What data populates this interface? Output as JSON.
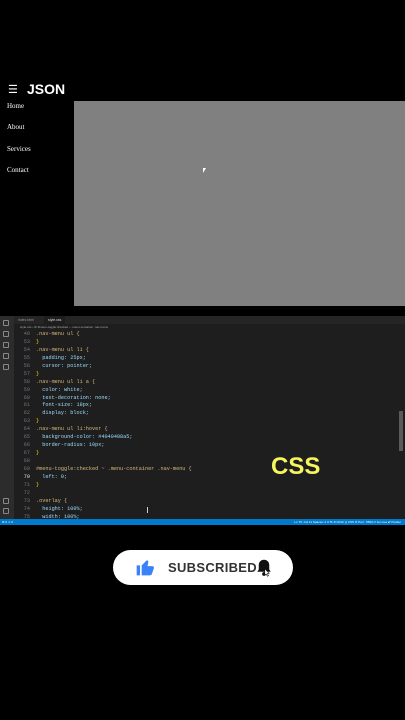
{
  "demo": {
    "menu_icon": "hamburger-icon",
    "menu_glyph": "☰",
    "title": "JSON",
    "nav": [
      "Home",
      "About",
      "Services",
      "Contact"
    ],
    "overlay_color": "#808080"
  },
  "editor": {
    "tabs": [
      "index.html",
      "style.css"
    ],
    "breadcrumb": "style.css › ⚙ #menu-toggle:checked ~ .menu-container .nav-menu",
    "status_left": "⊗ 0 ⚠ 0",
    "status_right": "Ln 70, Col 11   Spaces: 2   UTF-8   CRLF   {} CSS   ⦾ Port : 5500   ⊘ Go Live   ✔ Prettier",
    "accent": "#007acc",
    "lines": [
      {
        "n": "49",
        "text": ".nav-menu ul {"
      },
      {
        "n": "53",
        "text": "}"
      },
      {
        "n": "54",
        "text": ".nav-menu ul li {"
      },
      {
        "n": "55",
        "text": "  padding: 25px;"
      },
      {
        "n": "56",
        "text": "  cursor: pointer;"
      },
      {
        "n": "57",
        "text": "}"
      },
      {
        "n": "58",
        "text": ".nav-menu ul li a {"
      },
      {
        "n": "59",
        "text": "  color: white;"
      },
      {
        "n": "60",
        "text": "  text-decoration: none;"
      },
      {
        "n": "61",
        "text": "  font-size: 18px;"
      },
      {
        "n": "62",
        "text": "  display: block;"
      },
      {
        "n": "63",
        "text": "}"
      },
      {
        "n": "64",
        "text": ".nav-menu ul li:hover {"
      },
      {
        "n": "65",
        "text": "  background-color: #4040408a5;"
      },
      {
        "n": "66",
        "text": "  border-radius: 10px;"
      },
      {
        "n": "67",
        "text": "}"
      },
      {
        "n": "68",
        "text": ""
      },
      {
        "n": "69",
        "text": "#menu-toggle:checked ~ .menu-container .nav-menu {"
      },
      {
        "n": "70",
        "text": "  left: 0;"
      },
      {
        "n": "71",
        "text": "}"
      },
      {
        "n": "72",
        "text": ""
      },
      {
        "n": "73",
        "text": ".overlay {"
      },
      {
        "n": "74",
        "text": "  height: 100%;"
      },
      {
        "n": "75",
        "text": "  width: 100%;"
      }
    ]
  },
  "overlay_label": "CSS",
  "subscribe": {
    "label": "SUBSCRIBED",
    "thumb_icon": "thumbs-up-icon",
    "bell_icon": "bell-icon",
    "thumb_color": "#3b82f6"
  }
}
